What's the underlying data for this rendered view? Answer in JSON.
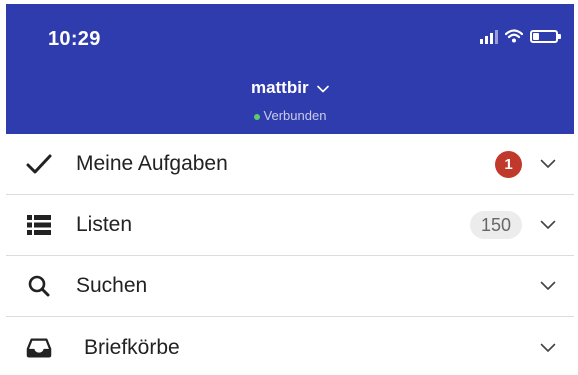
{
  "status_bar": {
    "time": "10:29",
    "battery_level": 0.25
  },
  "header": {
    "background_color": "#2f3cae",
    "account_name": "mattbir",
    "connection_status": "Verbunden",
    "connection_color": "#5ecb6b"
  },
  "menu": {
    "items": [
      {
        "label": "Meine Aufgaben",
        "icon": "checkmark-icon",
        "badge": "1",
        "badge_color": "#c0392b"
      },
      {
        "label": "Listen",
        "icon": "list-icon",
        "count": "150"
      },
      {
        "label": "Suchen",
        "icon": "search-icon"
      },
      {
        "label": "Briefkörbe",
        "icon": "inbox-tray-icon"
      }
    ]
  }
}
